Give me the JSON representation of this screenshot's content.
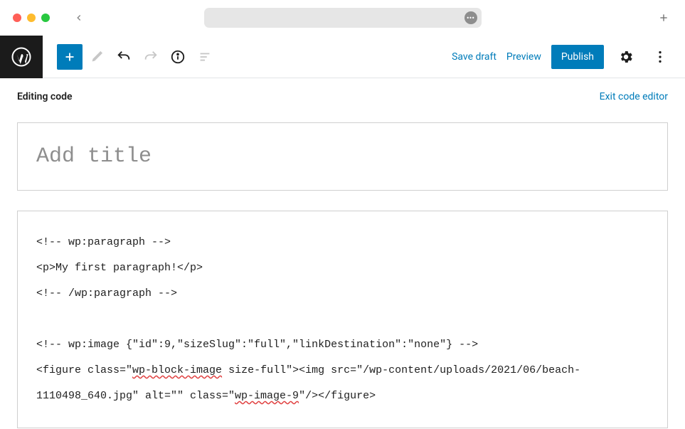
{
  "window": {
    "urlbar_badge": "•••"
  },
  "wpbar": {
    "save_draft": "Save draft",
    "preview": "Preview",
    "publish": "Publish"
  },
  "code_header": {
    "label": "Editing code",
    "exit": "Exit code editor"
  },
  "editor": {
    "title_placeholder": "Add title",
    "code_line1": "<!-- wp:paragraph -->",
    "code_line2": "<p>My first paragraph!</p>",
    "code_line3": "<!-- /wp:paragraph -->",
    "code_line4": "",
    "code_line5a": "<!-- wp:image {\"id\":9,\"sizeSlug\":\"full\",\"linkDestination\":\"none\"} -->",
    "code_line6a": "<figure class=\"",
    "code_squig1": "wp-block-image",
    "code_line6b": " size-full\"><img src=\"/wp-content/uploads/2021/06/beach-1110498_640.jpg\" alt=\"\" class=\"",
    "code_squig2": "wp-image-9",
    "code_line6c": "\"/></figure>"
  }
}
